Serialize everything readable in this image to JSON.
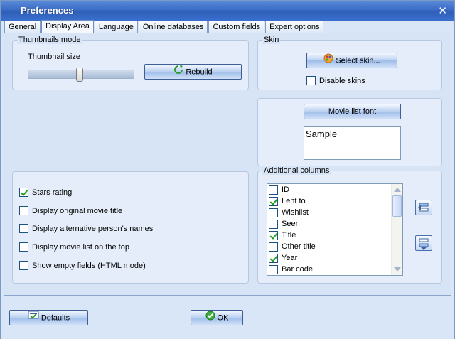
{
  "window": {
    "title": "Preferences"
  },
  "tabs": [
    {
      "label": "General",
      "active": false
    },
    {
      "label": "Display Area",
      "active": true
    },
    {
      "label": "Language",
      "active": false
    },
    {
      "label": "Online databases",
      "active": false
    },
    {
      "label": "Custom fields",
      "active": false
    },
    {
      "label": "Expert options",
      "active": false
    }
  ],
  "thumbnails": {
    "group_label": "Thumbnails mode",
    "size_label": "Thumbnail size",
    "rebuild_label": "Rebuild"
  },
  "skin": {
    "group_label": "Skin",
    "select_label": "Select skin...",
    "disable_label": "Disable skins",
    "disable_checked": false
  },
  "font": {
    "button_label": "Movie list font",
    "sample_text": "Sample"
  },
  "options": [
    {
      "label": "Stars rating",
      "checked": true
    },
    {
      "label": "Display original movie title",
      "checked": false
    },
    {
      "label": "Display alternative person's names",
      "checked": false
    },
    {
      "label": "Display movie list on the top",
      "checked": false
    },
    {
      "label": "Show empty fields (HTML mode)",
      "checked": false
    }
  ],
  "columns": {
    "group_label": "Additional columns",
    "items": [
      {
        "label": "ID",
        "checked": false
      },
      {
        "label": "Lent to",
        "checked": true
      },
      {
        "label": "Wishlist",
        "checked": false
      },
      {
        "label": "Seen",
        "checked": false
      },
      {
        "label": "Title",
        "checked": true
      },
      {
        "label": "Other title",
        "checked": false
      },
      {
        "label": "Year",
        "checked": true
      },
      {
        "label": "Bar code",
        "checked": false
      }
    ]
  },
  "footer": {
    "defaults_label": "Defaults",
    "ok_label": "OK"
  }
}
